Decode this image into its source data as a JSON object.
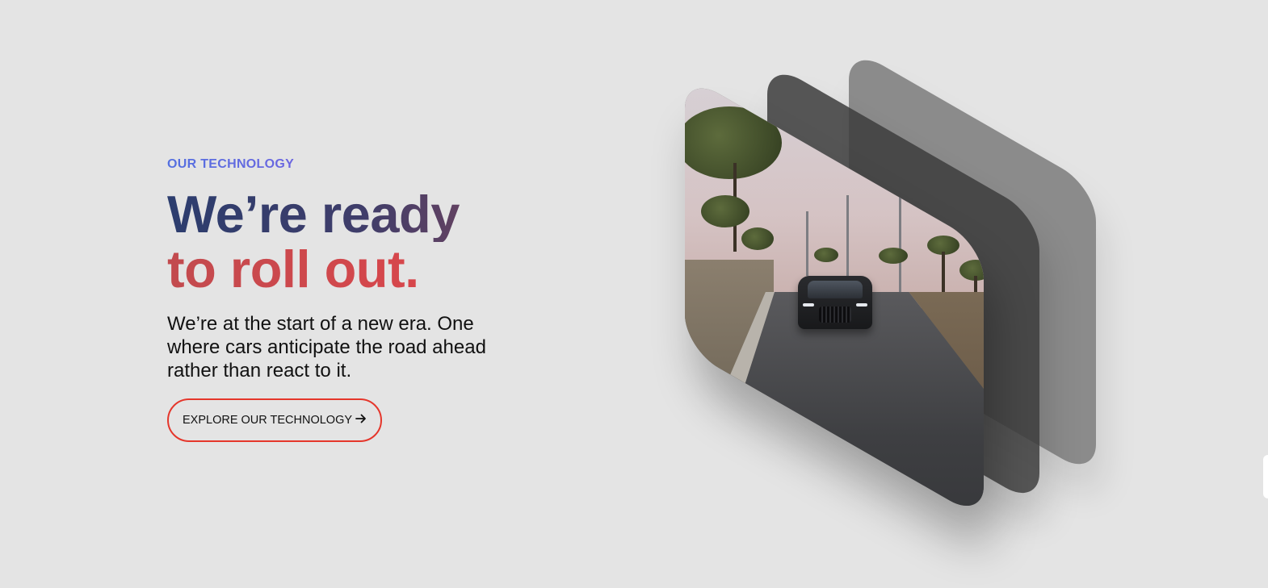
{
  "hero": {
    "eyebrow": "OUR TECHNOLOGY",
    "headline_line1": "We’re ready",
    "headline_line2": "to roll out.",
    "body": "We’re at the start of a new era. One where cars anticipate the road ahead rather than react to it.",
    "cta_label": "EXPLORE OUR TECHNOLOGY",
    "cta_icon": "arrow-right-icon"
  },
  "colors": {
    "background": "#e4e4e4",
    "eyebrow_gradient_start": "#5470e0",
    "headline_line1": "#2c3d6e",
    "headline_line2": "#e0454a",
    "cta_border": "#e5362b"
  },
  "media": {
    "description_icon": "driving-car-video",
    "layers": 3
  }
}
